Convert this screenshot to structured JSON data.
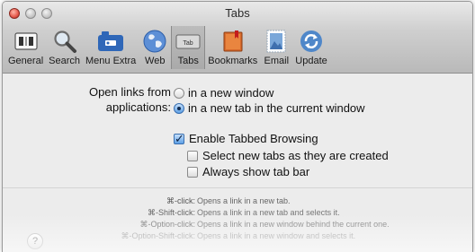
{
  "window": {
    "title": "Tabs"
  },
  "toolbar": {
    "items": [
      {
        "label": "General",
        "icon": "general-switch-icon"
      },
      {
        "label": "Search",
        "icon": "magnifier-icon"
      },
      {
        "label": "Menu Extra",
        "icon": "menu-extra-icon"
      },
      {
        "label": "Web",
        "icon": "globe-icon"
      },
      {
        "label": "Tabs",
        "icon": "tabs-icon",
        "selected": true
      },
      {
        "label": "Bookmarks",
        "icon": "bookmarks-book-icon"
      },
      {
        "label": "Email",
        "icon": "stamp-icon"
      },
      {
        "label": "Update",
        "icon": "refresh-icon"
      }
    ],
    "tabs_icon_text": "Tab"
  },
  "open_links": {
    "label_line1": "Open links from",
    "label_line2": "applications:",
    "option1": "in a new window",
    "option2": "in a new tab in the current window",
    "selected": 2
  },
  "tabbed_browsing": {
    "enable_label": "Enable Tabbed Browsing",
    "enable_checked": true,
    "select_new_label": "Select new tabs as they are created",
    "select_new_checked": false,
    "always_show_label": "Always show tab bar",
    "always_show_checked": false
  },
  "shortcuts": [
    {
      "key": "⌘-click:",
      "desc": "Opens a link in a new tab."
    },
    {
      "key": "⌘-Shift-click:",
      "desc": "Opens a link in a new tab and selects it."
    },
    {
      "key": "⌘-Option-click:",
      "desc": "Opens a link in a new window behind the current one."
    },
    {
      "key": "⌘-Option-Shift-click:",
      "desc": "Opens a link in a new window and selects it."
    }
  ],
  "help": {
    "label": "?"
  },
  "colors": {
    "accent": "#3a6fb0",
    "shortcut_key": "#555555",
    "shortcut_desc": "#777777"
  }
}
